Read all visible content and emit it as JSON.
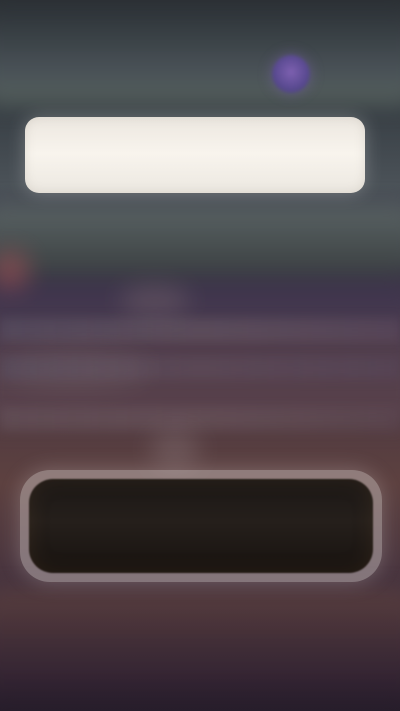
{
  "top_card": {
    "text": ""
  },
  "action_button": {
    "label": ""
  },
  "colors": {
    "avatar": "#6f5aa8",
    "top_card": "#f4efe8",
    "action_button": "#1c1714"
  },
  "icons": {
    "avatar": "profile-avatar"
  }
}
